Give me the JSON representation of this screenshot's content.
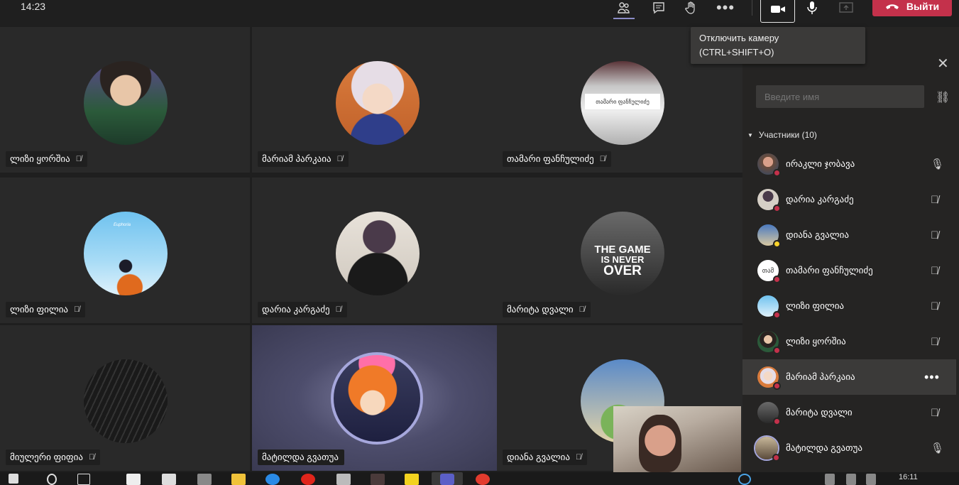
{
  "topbar": {
    "clock": "14:23",
    "leave_label": "Выйти"
  },
  "tooltip": {
    "line1": "Отключить камеру",
    "line2": "(CTRL+SHIFT+O)"
  },
  "tiles": [
    {
      "name": "ლიზი ყორშია"
    },
    {
      "name": "მარიამ პარკაია"
    },
    {
      "name": "თამარი ფანჩულიძე"
    },
    {
      "name": "ლიზი ფილია"
    },
    {
      "name": "დარია კარგაძე"
    },
    {
      "name": "მარიტა დვალი"
    },
    {
      "name": "მიულერი ფიფია"
    },
    {
      "name": "მატილდა გვათუა"
    },
    {
      "name": "დიანა გვალია"
    }
  ],
  "tile3_card_text": "თამარი ფანჩულიძე",
  "tile6_text": [
    "THE GAME",
    "IS NEVER",
    "OVER"
  ],
  "tile4_text": "Euphoria",
  "panel": {
    "search_placeholder": "Введите имя",
    "section_title": "Участники (10)",
    "participants": [
      {
        "name": "ირაკლი ჯობავა",
        "mic": "on"
      },
      {
        "name": "დარია კარგაძე",
        "mic": "off"
      },
      {
        "name": "დიანა გვალია",
        "mic": "off",
        "status": "away"
      },
      {
        "name": "თამარი ფანჩულიძე",
        "mic": "off",
        "initials": "თამ"
      },
      {
        "name": "ლიზი ფილია",
        "mic": "off"
      },
      {
        "name": "ლიზი ყორშია",
        "mic": "off"
      },
      {
        "name": "მარიამ პარკაია",
        "mic": "more"
      },
      {
        "name": "მარიტა დვალი",
        "mic": "off"
      },
      {
        "name": "მატილდა გვათუა",
        "mic": "on"
      }
    ]
  },
  "taskbar": {
    "time": "16:11"
  },
  "colors": {
    "leave": "#c4314b",
    "accent": "#8b8cc7",
    "speaking_ring": "#a6a7dc"
  }
}
